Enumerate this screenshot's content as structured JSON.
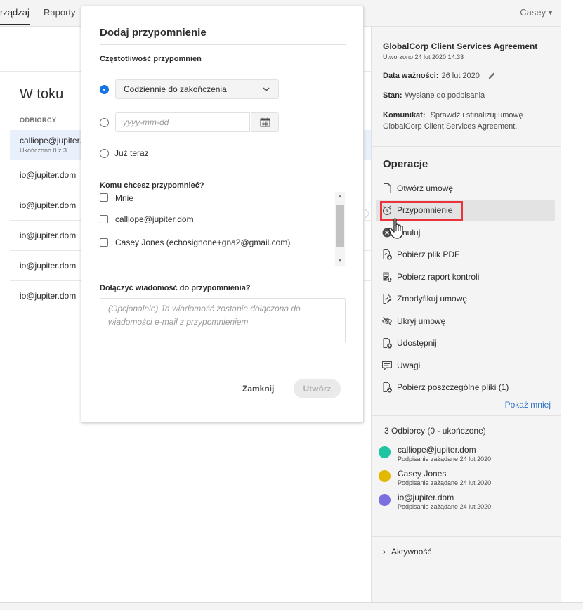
{
  "topnav": {
    "tabs": [
      {
        "label": "rządzaj",
        "active": true
      },
      {
        "label": "Raporty",
        "active": false
      }
    ],
    "user": "Casey"
  },
  "list": {
    "title": "W toku",
    "column_header": "ODBIORCY",
    "rows": [
      {
        "email": "calliope@jupiter.d",
        "sub": "Ukończono 0 z 3",
        "selected": true
      },
      {
        "email": "io@jupiter.dom"
      },
      {
        "email": "io@jupiter.dom"
      },
      {
        "email": "io@jupiter.dom"
      },
      {
        "email": "io@jupiter.dom"
      },
      {
        "email": "io@jupiter.dom"
      }
    ]
  },
  "modal": {
    "title": "Dodaj przypomnienie",
    "frequency_label": "Częstotliwość przypomnień",
    "frequency_select_value": "Codziennie do zakończenia",
    "date_placeholder": "yyyy-mm-dd",
    "now_label": "Już teraz",
    "selected_option": "frequency",
    "who_label": "Komu chcesz przypomnieć?",
    "recipients": [
      {
        "label": "Mnie",
        "checked": false
      },
      {
        "label": "calliope@jupiter.dom",
        "checked": false
      },
      {
        "label": "Casey Jones (echosignone+gna2@gmail.com)",
        "checked": false
      }
    ],
    "message_label": "Dołączyć wiadomość do przypomnienia?",
    "message_placeholder": "(Opcjonalnie) Ta wiadomość zostanie dołączona do wiadomości e-mail z przypomnieniem",
    "close_label": "Zamknij",
    "create_label": "Utwórz"
  },
  "details": {
    "title": "GlobalCorp Client Services Agreement",
    "created": "Utworzono 24 lut 2020 14:33",
    "expiry_label": "Data ważności:",
    "expiry_value": "26 lut 2020",
    "status_label": "Stan:",
    "status_value": "Wysłane do podpisania",
    "message_label": "Komunikat:",
    "message_value": "Sprawdź i sfinalizuj umowę GlobalCorp Client Services Agreement."
  },
  "operations": {
    "title": "Operacje",
    "items": [
      {
        "label": "Otwórz umowę",
        "icon": "document-icon"
      },
      {
        "label": "Przypomnienie",
        "icon": "alarm-clock-icon",
        "hovered": true
      },
      {
        "label": "Anuluj",
        "icon": "cancel-icon"
      },
      {
        "label": "Pobierz plik PDF",
        "icon": "download-pdf-icon"
      },
      {
        "label": "Pobierz raport kontroli",
        "icon": "audit-report-icon"
      },
      {
        "label": "Zmodyfikuj umowę",
        "icon": "edit-document-icon"
      },
      {
        "label": "Ukryj umowę",
        "icon": "hide-icon"
      },
      {
        "label": "Udostępnij",
        "icon": "share-icon"
      },
      {
        "label": "Uwagi",
        "icon": "comment-icon"
      },
      {
        "label": "Pobierz poszczególne pliki (1)",
        "icon": "download-files-icon"
      }
    ],
    "show_less": "Pokaż mniej"
  },
  "recipients": {
    "title": "3 Odbiorcy (0 - ukończone)",
    "items": [
      {
        "name": "calliope@jupiter.dom",
        "status": "Podpisanie zażądane 24 lut 2020",
        "color": "#1fc4a0"
      },
      {
        "name": "Casey Jones",
        "status": "Podpisanie zażądane 24 lut 2020",
        "color": "#e3b800"
      },
      {
        "name": "io@jupiter.dom",
        "status": "Podpisanie zażądane 24 lut 2020",
        "color": "#7b6fe0"
      }
    ]
  },
  "activity": {
    "label": "Aktywność"
  },
  "colors": {
    "accent": "#1473e6",
    "highlight": "#e8343a",
    "link": "#2d6fc4",
    "panel_bg": "#f4f4f4"
  }
}
